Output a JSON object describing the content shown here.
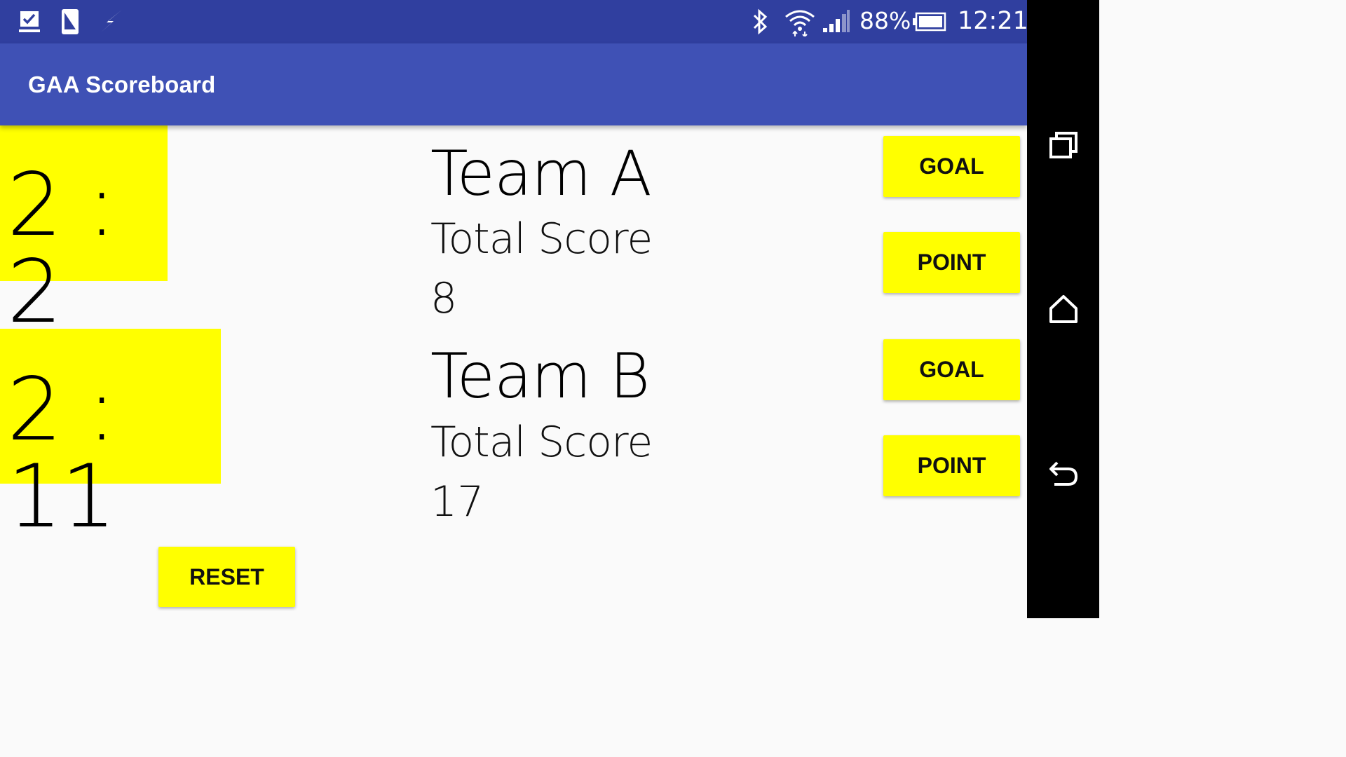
{
  "status_bar": {
    "left_icons": [
      "task-checkbox-icon",
      "phone-screen-icon",
      "flash-icon"
    ],
    "right_icons": [
      "bluetooth-icon",
      "wifi-icon",
      "cell-signal-icon",
      "battery-icon"
    ],
    "battery_percent": "88%",
    "time": "12:21"
  },
  "app_bar": {
    "title": "GAA Scoreboard"
  },
  "scores": {
    "team_a": {
      "goals_points": "2 : 2"
    },
    "team_b": {
      "goals_points": "2 : 11"
    }
  },
  "teams": [
    {
      "name": "Team A",
      "total_label": "Total Score",
      "total_value": "8"
    },
    {
      "name": "Team B",
      "total_label": "Total Score",
      "total_value": "17"
    }
  ],
  "buttons": {
    "team_a_goal": "GOAL",
    "team_a_point": "POINT",
    "team_b_goal": "GOAL",
    "team_b_point": "POINT",
    "reset": "RESET"
  },
  "nav_bar": {
    "icons": [
      "recents-icon",
      "home-icon",
      "back-icon"
    ]
  },
  "colors": {
    "status_bar": "#303f9f",
    "app_bar": "#3f51b5",
    "accent_yellow": "#ffff00",
    "background": "#fafafa"
  }
}
